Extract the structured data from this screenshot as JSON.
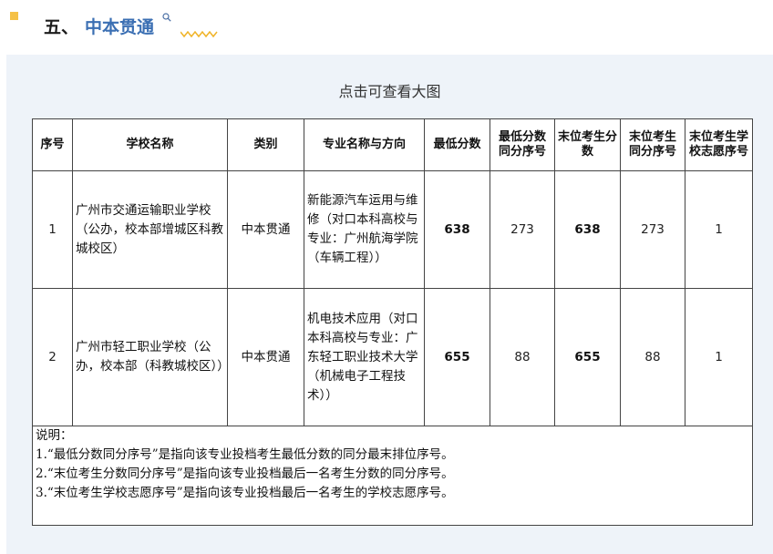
{
  "heading": {
    "number": "五、",
    "title": "中本贯通"
  },
  "panel": {
    "caption": "点击可查看大图"
  },
  "table": {
    "headers": {
      "seq": "序号",
      "school": "学校名称",
      "category": "类别",
      "major": "专业名称与方向",
      "min_score": "最低分数",
      "min_score_rank": "最低分数同分序号",
      "last_score": "末位考生分数",
      "last_score_rank": "末位考生同分序号",
      "last_wish": "末位考生学校志愿序号"
    },
    "rows": [
      {
        "seq": "1",
        "school": "广州市交通运输职业学校（公办，校本部增城区科教城校区）",
        "category": "中本贯通",
        "major": "新能源汽车运用与维修（对口本科高校与专业：广州航海学院（车辆工程））",
        "min_score": "638",
        "min_score_rank": "273",
        "last_score": "638",
        "last_score_rank": "273",
        "last_wish": "1"
      },
      {
        "seq": "2",
        "school": "广州市轻工职业学校（公办，校本部（科教城校区））",
        "category": "中本贯通",
        "major": "机电技术应用（对口本科高校与专业：广东轻工职业技术大学（机械电子工程技术））",
        "min_score": "655",
        "min_score_rank": "88",
        "last_score": "655",
        "last_score_rank": "88",
        "last_wish": "1"
      }
    ],
    "notes": {
      "title": "说明：",
      "lines": [
        "1.“最低分数同分序号”是指向该专业投档考生最低分数的同分最末排位序号。",
        "2.“末位考生分数同分序号”是指向该专业投档最后一名考生分数的同分序号。",
        "3.“末位考生学校志愿序号”是指向该专业投档最后一名考生的学校志愿序号。"
      ]
    }
  }
}
